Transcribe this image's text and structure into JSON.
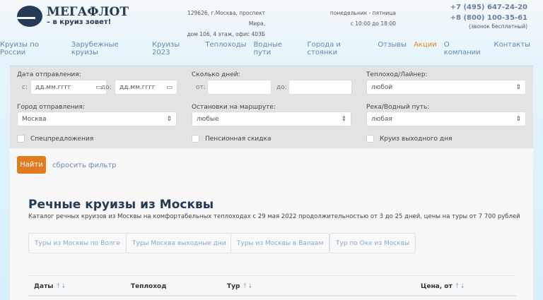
{
  "header": {
    "logo_title": "МЕГАФЛОТ",
    "logo_slogan": "– в круиз зовет!",
    "address_line1": "129626, г.Москва, проспект Мира,",
    "address_line2": "дом 106, 4 этаж, офис 403Б",
    "hours_line1": "понедельник - пятница",
    "hours_line2": "с 10:00 до 18:00",
    "phone1": "+7 (495) 647-24-20",
    "phone2": "+8 (800) 100-35-61",
    "phone_note": "(звонок бесплатный)"
  },
  "nav": [
    "Круизы по России",
    "Зарубежные круизы",
    "Круизы 2023",
    "Теплоходы",
    "Водные пути",
    "Города и стоянки",
    "Отзывы",
    "Акции",
    "О компании",
    "Контакты"
  ],
  "filter": {
    "date_label": "Дата отправления:",
    "from": "с:",
    "to": "до:",
    "date_placeholder": "дд.мм.гггг",
    "days_label": "Сколько дней:",
    "days_from": "от:",
    "days_to": "до:",
    "ship_label": "Теплоход/Лайнер:",
    "ship_value": "любой",
    "city_label": "Город отправления:",
    "city_value": "Москва",
    "stops_label": "Остановки на маршруте:",
    "stops_value": "любые",
    "river_label": "Река/Водный путь:",
    "river_value": "любая",
    "cb1": "Спецпредложения",
    "cb2": "Пенсионная скидка",
    "cb3": "Круиз выходного дня",
    "search": "Найти",
    "reset": "сбросить фильтр"
  },
  "main": {
    "title": "Речные круизы из Москвы",
    "description": "Каталог речных круизов из Москвы на комфортабельных теплоходах с 29 мая 2022 продолжительностью от 3 до 25 дней, цены на туры от 7 700 рублей",
    "chips": [
      "Туры из Москвы по Волге",
      "Туры Москва выходные дни",
      "Туры из Москвы в Валаам",
      "Тур по Оке из Москвы"
    ],
    "columns": [
      "Даты",
      "Теплоход",
      "Тур",
      "Цена, от"
    ],
    "sort_arrows": "↑↓"
  },
  "colors": {
    "accent": "#e07b1f",
    "brand": "#253a55",
    "link": "#5b8ab5"
  }
}
